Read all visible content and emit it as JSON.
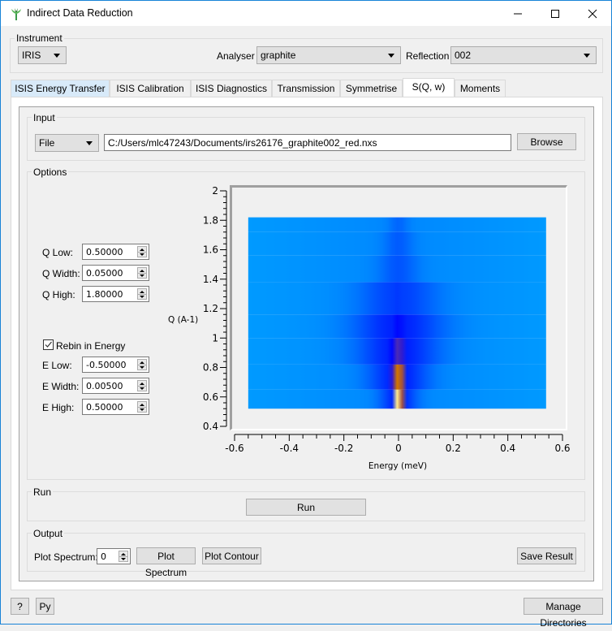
{
  "window": {
    "title": "Indirect Data Reduction",
    "icon": "mantid-logo-icon",
    "controls": [
      "minimize-icon",
      "maximize-icon",
      "close-icon"
    ]
  },
  "instrument_group": {
    "title": "Instrument",
    "instrument": "IRIS",
    "analyser_label": "Analyser",
    "analyser": "graphite",
    "reflection_label": "Reflection",
    "reflection": "002"
  },
  "tabs": [
    {
      "label": "ISIS Energy Transfer",
      "state": "hover"
    },
    {
      "label": "ISIS Calibration",
      "state": "normal"
    },
    {
      "label": "ISIS Diagnostics",
      "state": "normal"
    },
    {
      "label": "Transmission",
      "state": "normal"
    },
    {
      "label": "Symmetrise",
      "state": "normal"
    },
    {
      "label": "S(Q, w)",
      "state": "active"
    },
    {
      "label": "Moments",
      "state": "normal"
    }
  ],
  "input": {
    "title": "Input",
    "source_type": "File",
    "file_path": "C:/Users/mlc47243/Documents/irs26176_graphite002_red.nxs",
    "browse_label": "Browse"
  },
  "options": {
    "title": "Options",
    "q_low_label": "Q Low:",
    "q_low": "0.50000",
    "q_width_label": "Q Width:",
    "q_width": "0.05000",
    "q_high_label": "Q High:",
    "q_high": "1.80000",
    "rebin_label": "Rebin in Energy",
    "rebin_checked": true,
    "e_low_label": "E Low:",
    "e_low": "-0.50000",
    "e_width_label": "E Width:",
    "e_width": "0.00500",
    "e_high_label": "E High:",
    "e_high": "0.50000"
  },
  "chart_data": {
    "type": "heatmap",
    "title": "",
    "xlabel": "Energy (meV)",
    "ylabel": "Q (A-1)",
    "xlim": [
      -0.6,
      0.6
    ],
    "ylim": [
      0.4,
      2.0
    ],
    "x_ticks": [
      "-0.6",
      "-0.4",
      "-0.2",
      "0",
      "0.2",
      "0.4",
      "0.6"
    ],
    "y_ticks": [
      "0.4",
      "0.6",
      "0.8",
      "1",
      "1.2",
      "1.4",
      "1.6",
      "1.8",
      "2"
    ],
    "data_extent": {
      "x": [
        -0.55,
        0.54
      ],
      "y": [
        0.52,
        1.82
      ]
    },
    "q_rows": [
      {
        "q_range": [
          0.52,
          0.65
        ],
        "peak_intensity": 1.0,
        "peak_width": 0.018
      },
      {
        "q_range": [
          0.65,
          0.82
        ],
        "peak_intensity": 0.72,
        "peak_width": 0.03
      },
      {
        "q_range": [
          0.82,
          1.0
        ],
        "peak_intensity": 0.45,
        "peak_width": 0.04
      },
      {
        "q_range": [
          1.0,
          1.16
        ],
        "peak_intensity": 0.32,
        "peak_width": 0.045
      },
      {
        "q_range": [
          1.16,
          1.38
        ],
        "peak_intensity": 0.22,
        "peak_width": 0.04
      },
      {
        "q_range": [
          1.38,
          1.56
        ],
        "peak_intensity": 0.15,
        "peak_width": 0.02
      },
      {
        "q_range": [
          1.56,
          1.72
        ],
        "peak_intensity": 0.13,
        "peak_width": 0.015
      },
      {
        "q_range": [
          1.72,
          1.82
        ],
        "peak_intensity": 0.1,
        "peak_width": 0.01
      }
    ],
    "colormap": [
      "#00a6ff",
      "#0050ff",
      "#0000ff",
      "#704090",
      "#c86000",
      "#ffcc00",
      "#ffffff"
    ],
    "grid": false,
    "legend": "none"
  },
  "run": {
    "title": "Run",
    "run_label": "Run"
  },
  "output": {
    "title": "Output",
    "plot_spectrum_label": "Plot Spectrum:",
    "plot_spectrum_value": "0",
    "plot_spectrum_button": "Plot Spectrum",
    "plot_contour_button": "Plot Contour",
    "save_result_button": "Save Result"
  },
  "footer": {
    "help_label": "?",
    "python_label": "Py",
    "manage_dirs_label": "Manage Directories"
  }
}
